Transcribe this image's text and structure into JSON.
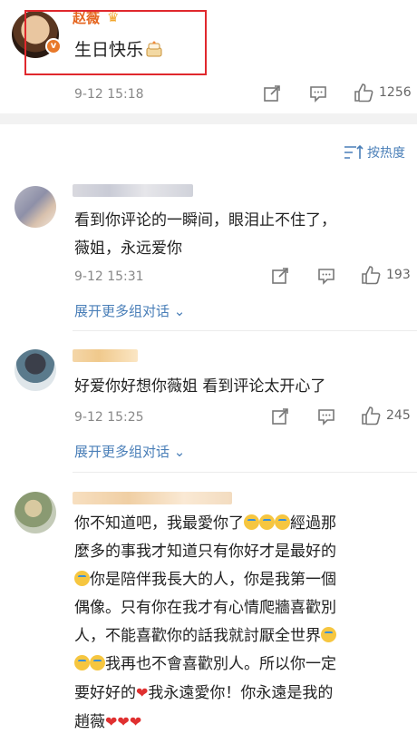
{
  "post": {
    "author": "赵薇",
    "text": "生日快乐",
    "time": "9-12 15:18",
    "likes": "1256"
  },
  "sort_label": "按热度",
  "comments": [
    {
      "text_line1": "看到你评论的一瞬间，眼泪止不住了，",
      "text_line2": "薇姐，永远爱你",
      "time": "9-12 15:31",
      "likes": "193",
      "expand": "展开更多组对话"
    },
    {
      "text": "好爱你好想你薇姐 看到评论太开心了",
      "time": "9-12 15:25",
      "likes": "245",
      "expand": "展开更多组对话"
    },
    {
      "line1a": "你不知道吧，我最愛你了",
      "line1b": "經過那",
      "line2": "麼多的事我才知道只有你好才是最好的",
      "line3": "你是陪伴我長大的人，你是我第一個",
      "line4": "偶像。只有你在我才有心情爬牆喜歡別",
      "line5": "人，不能喜歡你的話我就討厭全世界",
      "line6": "我再也不會喜歡別人。所以你一定",
      "line7a": "要好好的",
      "line7b": "我永遠愛你！你永遠是我的",
      "line8": "趙薇"
    }
  ],
  "colors": {
    "link": "#4a7fb8",
    "author": "#e5651f",
    "highlight": "#e0282d"
  }
}
